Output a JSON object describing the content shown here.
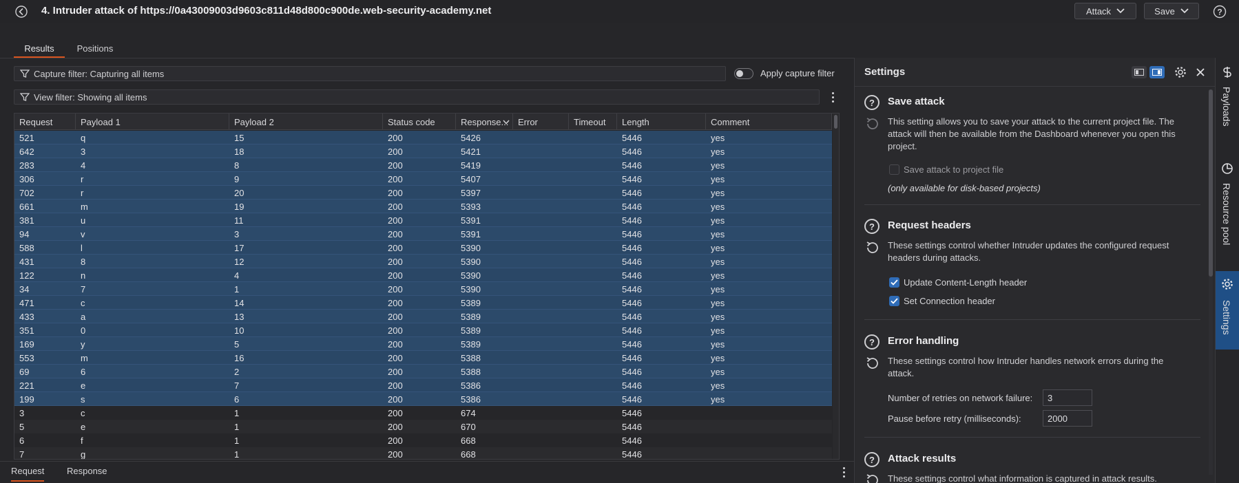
{
  "window": {
    "title": "4. Intruder attack of https://0a43009003d9603c811d48d800c900de.web-security-academy.net",
    "attack_label": "Attack",
    "save_label": "Save"
  },
  "tabs": [
    {
      "label": "Results",
      "active": true
    },
    {
      "label": "Positions",
      "active": false
    }
  ],
  "filters": {
    "capture": "Capture filter: Capturing all items",
    "view": "View filter: Showing all items",
    "apply_capture_label": "Apply capture filter",
    "apply_capture_on": false
  },
  "table": {
    "columns": [
      "Request",
      "Payload 1",
      "Payload 2",
      "Status code",
      "Response...",
      "Error",
      "Timeout",
      "Length",
      "Comment"
    ],
    "rows": [
      {
        "cells": [
          "521",
          "q",
          "15",
          "200",
          "5426",
          "",
          "",
          "5446",
          "yes"
        ],
        "selected": true
      },
      {
        "cells": [
          "642",
          "3",
          "18",
          "200",
          "5421",
          "",
          "",
          "5446",
          "yes"
        ],
        "selected": true
      },
      {
        "cells": [
          "283",
          "4",
          "8",
          "200",
          "5419",
          "",
          "",
          "5446",
          "yes"
        ],
        "selected": true
      },
      {
        "cells": [
          "306",
          "r",
          "9",
          "200",
          "5407",
          "",
          "",
          "5446",
          "yes"
        ],
        "selected": true
      },
      {
        "cells": [
          "702",
          "r",
          "20",
          "200",
          "5397",
          "",
          "",
          "5446",
          "yes"
        ],
        "selected": true
      },
      {
        "cells": [
          "661",
          "m",
          "19",
          "200",
          "5393",
          "",
          "",
          "5446",
          "yes"
        ],
        "selected": true
      },
      {
        "cells": [
          "381",
          "u",
          "11",
          "200",
          "5391",
          "",
          "",
          "5446",
          "yes"
        ],
        "selected": true
      },
      {
        "cells": [
          "94",
          "v",
          "3",
          "200",
          "5391",
          "",
          "",
          "5446",
          "yes"
        ],
        "selected": true
      },
      {
        "cells": [
          "588",
          "l",
          "17",
          "200",
          "5390",
          "",
          "",
          "5446",
          "yes"
        ],
        "selected": true
      },
      {
        "cells": [
          "431",
          "8",
          "12",
          "200",
          "5390",
          "",
          "",
          "5446",
          "yes"
        ],
        "selected": true
      },
      {
        "cells": [
          "122",
          "n",
          "4",
          "200",
          "5390",
          "",
          "",
          "5446",
          "yes"
        ],
        "selected": true
      },
      {
        "cells": [
          "34",
          "7",
          "1",
          "200",
          "5390",
          "",
          "",
          "5446",
          "yes"
        ],
        "selected": true
      },
      {
        "cells": [
          "471",
          "c",
          "14",
          "200",
          "5389",
          "",
          "",
          "5446",
          "yes"
        ],
        "selected": true
      },
      {
        "cells": [
          "433",
          "a",
          "13",
          "200",
          "5389",
          "",
          "",
          "5446",
          "yes"
        ],
        "selected": true
      },
      {
        "cells": [
          "351",
          "0",
          "10",
          "200",
          "5389",
          "",
          "",
          "5446",
          "yes"
        ],
        "selected": true
      },
      {
        "cells": [
          "169",
          "y",
          "5",
          "200",
          "5389",
          "",
          "",
          "5446",
          "yes"
        ],
        "selected": true
      },
      {
        "cells": [
          "553",
          "m",
          "16",
          "200",
          "5388",
          "",
          "",
          "5446",
          "yes"
        ],
        "selected": true
      },
      {
        "cells": [
          "69",
          "6",
          "2",
          "200",
          "5388",
          "",
          "",
          "5446",
          "yes"
        ],
        "selected": true
      },
      {
        "cells": [
          "221",
          "e",
          "7",
          "200",
          "5386",
          "",
          "",
          "5446",
          "yes"
        ],
        "selected": true
      },
      {
        "cells": [
          "199",
          "s",
          "6",
          "200",
          "5386",
          "",
          "",
          "5446",
          "yes"
        ],
        "selected": true
      },
      {
        "cells": [
          "3",
          "c",
          "1",
          "200",
          "674",
          "",
          "",
          "5446",
          ""
        ],
        "selected": false
      },
      {
        "cells": [
          "5",
          "e",
          "1",
          "200",
          "670",
          "",
          "",
          "5446",
          ""
        ],
        "selected": false
      },
      {
        "cells": [
          "6",
          "f",
          "1",
          "200",
          "668",
          "",
          "",
          "5446",
          ""
        ],
        "selected": false
      },
      {
        "cells": [
          "7",
          "g",
          "1",
          "200",
          "668",
          "",
          "",
          "5446",
          ""
        ],
        "selected": false
      }
    ]
  },
  "bottom_tabs": [
    {
      "label": "Request",
      "active": true
    },
    {
      "label": "Response",
      "active": false
    }
  ],
  "settings": {
    "title": "Settings",
    "save_attack": {
      "title": "Save attack",
      "description": "This setting allows you to save your attack to the current project file. The attack will then be available from the Dashboard whenever you open this project.",
      "checkbox_label": "Save attack to project file",
      "note": "(only available for disk-based projects)"
    },
    "request_headers": {
      "title": "Request headers",
      "description": "These settings control whether Intruder updates the configured request headers during attacks.",
      "update_content_length": "Update Content-Length header",
      "set_connection": "Set Connection header"
    },
    "error_handling": {
      "title": "Error handling",
      "description": "These settings control how Intruder handles network errors during the attack.",
      "retries_label": "Number of retries on network failure:",
      "retries_value": "3",
      "pause_label": "Pause before retry (milliseconds):",
      "pause_value": "2000"
    },
    "attack_results": {
      "title": "Attack results",
      "description": "These settings control what information is captured in attack results."
    }
  },
  "rail": {
    "payloads": "Payloads",
    "resource_pool": "Resource pool",
    "settings": "Settings"
  },
  "colors": {
    "accent": "#d9541f",
    "selected_row": "#2a4766",
    "rail_active": "#1f4f86",
    "checkbox_on": "#2f6cb7"
  }
}
